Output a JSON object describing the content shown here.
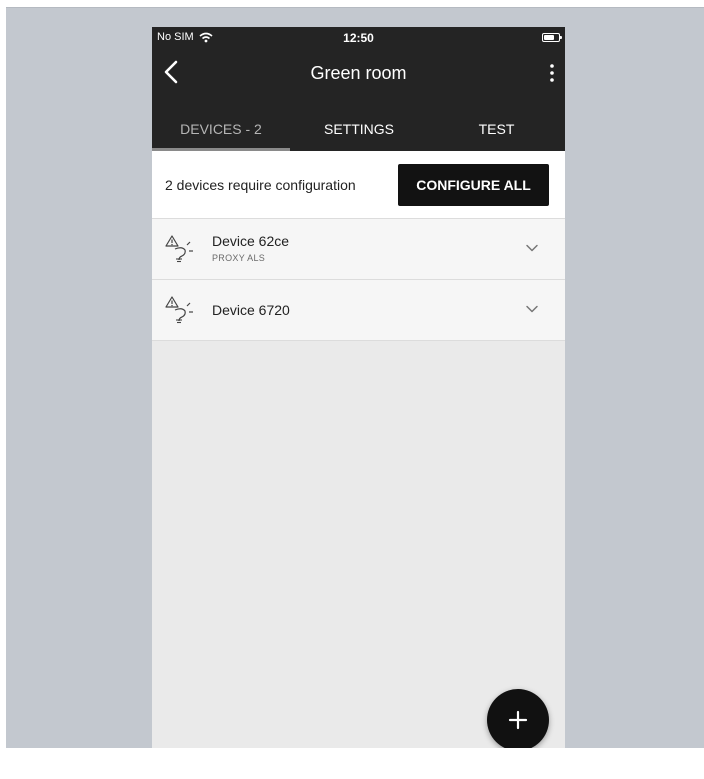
{
  "status_bar": {
    "carrier": "No SIM",
    "time": "12:50"
  },
  "nav": {
    "title": "Green room",
    "back_icon": "chevron-left-icon",
    "menu_icon": "more-vertical-icon"
  },
  "tabs": [
    {
      "label": "DEVICES - 2",
      "active": true
    },
    {
      "label": "SETTINGS",
      "active": false
    },
    {
      "label": "TEST",
      "active": false
    }
  ],
  "config": {
    "message": "2 devices require configuration",
    "button_label": "CONFIGURE ALL"
  },
  "devices": [
    {
      "name": "Device 62ce",
      "subtitle": "PROXY ALS",
      "icon": "warning-lightbulb-icon"
    },
    {
      "name": "Device 6720",
      "subtitle": "",
      "icon": "warning-lightbulb-icon"
    }
  ],
  "fab": {
    "icon": "plus-icon"
  },
  "colors": {
    "header": "#242424",
    "frame_bg": "#c3c8cf",
    "content_bg": "#eaeaea",
    "button_bg": "#121212"
  }
}
